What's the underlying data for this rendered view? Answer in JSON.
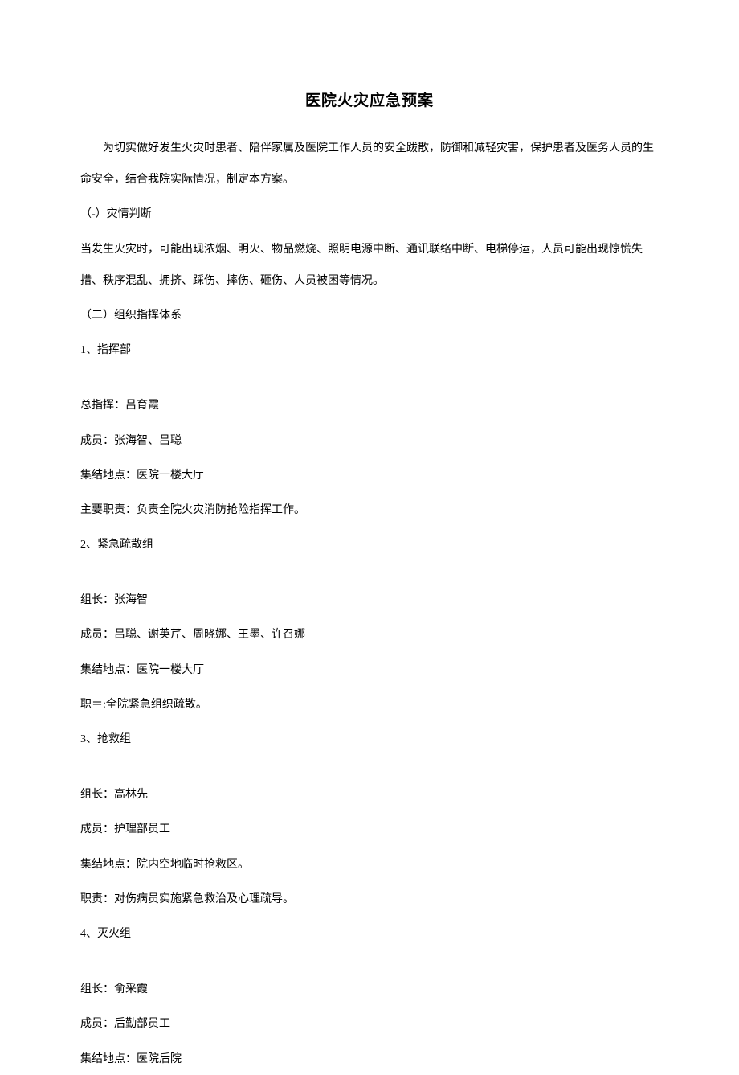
{
  "title": "医院火灾应急预案",
  "intro": "为切实做好发生火灾时患者、陪伴家属及医院工作人员的安全跋散，防御和减轻灾害，保护患者及医务人员的生命安全，结合我院实际情况，制定本方案。",
  "section1": {
    "heading": "（-）灾情判断",
    "text": "当发生火灾时，可能出现浓烟、明火、物品燃烧、照明电源中断、通讯联络中断、电梯停运，人员可能出现惊慌失措、秩序混乱、拥挤、踩伤、摔伤、砸伤、人员被困等情况。"
  },
  "section2": {
    "heading": "（二）组织指挥体系",
    "group1": {
      "label": "1、指挥部",
      "commander": "总指挥：吕育霞",
      "members": "成员：张海智、吕聪",
      "location": "集结地点：医院一楼大厅",
      "duty": "主要职责：负责全院火灾消防抢险指挥工作。"
    },
    "group2": {
      "label": "2、紧急疏散组",
      "leader": "组长：张海智",
      "members": "成员：吕聪、谢英芹、周晓娜、王墨、许召娜",
      "location": "集结地点：医院一楼大厅",
      "duty": "职＝:全院紧急组织疏散。"
    },
    "group3": {
      "label": "3、抢救组",
      "leader": "组长：高林先",
      "members": "成员：护理部员工",
      "location": "集结地点：院内空地临时抢救区。",
      "duty": "职责：对伤病员实施紧急救治及心理疏导。"
    },
    "group4": {
      "label": "4、灭火组",
      "leader": "组长：俞采霞",
      "members": "成员：后勤部员工",
      "location": "集结地点：医院后院"
    }
  }
}
